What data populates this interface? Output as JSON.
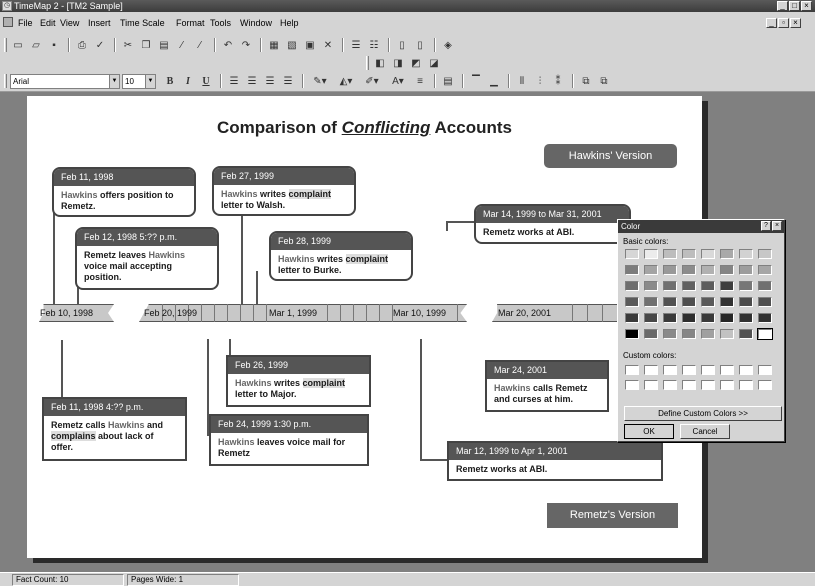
{
  "window": {
    "title": "TimeMap 2 - [TM2 Sample]",
    "controls": [
      "_",
      "□",
      "×"
    ],
    "mdi_controls": [
      "_",
      "▫",
      "×"
    ]
  },
  "menu": [
    "File",
    "Edit",
    "View",
    "Insert",
    "Time Scale",
    "Format",
    "Tools",
    "Window",
    "Help"
  ],
  "toolbar": {
    "font_name": "Arial",
    "font_size": "10",
    "bold": "B",
    "italic": "I",
    "underline": "U"
  },
  "document": {
    "title_prefix": "Comparison of ",
    "title_emphasis": "Conflicting",
    "title_suffix": " Accounts",
    "hawkins_tag": "Hawkins' Version",
    "remetz_tag": "Remetz's Version"
  },
  "timeline": {
    "band1_label": "Feb 10, 1998",
    "band2_labels": [
      "Feb 20, 1999",
      "Mar 1, 1999",
      "Mar 10, 1999"
    ],
    "band3_label": "Mar 20, 2001"
  },
  "facts": {
    "f1": {
      "date": "Feb 11, 1998",
      "b1": "Hawkins",
      "b2": " offers position to Remetz."
    },
    "f2": {
      "date": "Feb 27, 1999",
      "b1": "Hawkins",
      "b2": " writes ",
      "b3": "complaint",
      "b4": " letter to Walsh."
    },
    "f3": {
      "date": "Feb 12, 1998 5:?? p.m.",
      "b1": "Remetz leaves ",
      "b2": "Hawkins",
      "b3": " voice mail accepting position."
    },
    "f4": {
      "date": "Feb 28, 1999",
      "b1": "Hawkins",
      "b2": " writes ",
      "b3": "complaint",
      "b4": " letter to Burke."
    },
    "f5": {
      "date": "Mar 14, 1999 to Mar 31, 2001",
      "b1": "Remetz works at ABI."
    },
    "f6": {
      "date": "Feb 26, 1999",
      "b1": "Hawkins",
      "b2": " writes ",
      "b3": "complaint",
      "b4": " letter to Major."
    },
    "f7": {
      "date": "Mar 24, 2001",
      "b1": "Hawkins",
      "b2": " calls Remetz and curses at him."
    },
    "f8": {
      "date": "Feb 11, 1998 4:?? p.m.",
      "b1": "Remetz calls ",
      "b2": "Hawkins",
      "b3": " and ",
      "b4": "complains",
      "b5": " about lack of offer."
    },
    "f9": {
      "date": "Feb 24, 1999 1:30 p.m.",
      "b1": "Hawkins",
      "b2": " leaves voice mail for Remetz"
    },
    "f10": {
      "date": "Mar 12, 1999 to Apr 1, 2001",
      "b1": "Remetz works at ABI."
    }
  },
  "color_dialog": {
    "title": "Color",
    "help_btn": "?",
    "close_btn": "×",
    "basic_label": "Basic colors:",
    "custom_label": "Custom colors:",
    "define_btn": "Define Custom Colors >>",
    "ok_btn": "OK",
    "cancel_btn": "Cancel",
    "basic_colors": [
      "#d6d6d6",
      "#ececec",
      "#bdbdbd",
      "#bdbdbd",
      "#d9d9d9",
      "#a9a9a9",
      "#d2d2d2",
      "#c7c7c7",
      "#7c7c7c",
      "#a4a4a4",
      "#999999",
      "#8c8c8c",
      "#b1b1b1",
      "#858585",
      "#9d9d9d",
      "#a6a6a6",
      "#6e6e6e",
      "#8a8a8a",
      "#707070",
      "#606060",
      "#5d5d5d",
      "#3e3e3e",
      "#777777",
      "#707070",
      "#5a5a5a",
      "#707070",
      "#525252",
      "#4f4f4f",
      "#5a5a5a",
      "#323232",
      "#4b4b4b",
      "#4f4f4f",
      "#3a3a3a",
      "#474747",
      "#3a3a3a",
      "#2e2e2e",
      "#3a3a3a",
      "#272727",
      "#323232",
      "#323232",
      "#000000",
      "#6a6a6a",
      "#8a8a8a",
      "#868686",
      "#a0a0a0",
      "#c2c2c2",
      "#525252",
      "#ffffff"
    ]
  },
  "status": {
    "fact_count": "Fact Count: 10",
    "pages_wide": "Pages Wide: 1"
  }
}
